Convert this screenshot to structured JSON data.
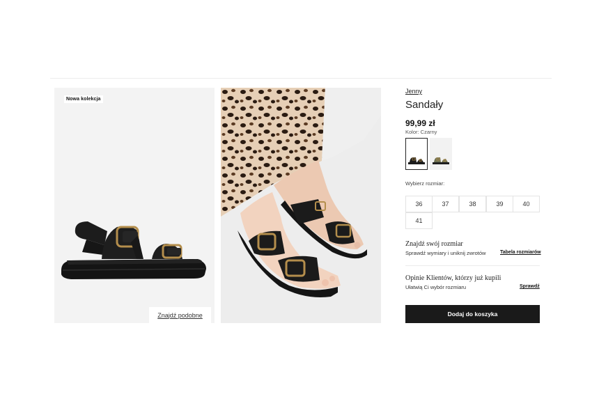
{
  "gallery": {
    "badge": "Nowa kolekcja",
    "find_similar": "Znajdź podobne"
  },
  "product": {
    "brand": "Jenny",
    "title": "Sandały",
    "price": "99,99 zł",
    "color_label": "Kolor: Czarny",
    "swatches": [
      {
        "name": "black",
        "color": "#1c1c1c",
        "selected": true
      },
      {
        "name": "olive",
        "color": "#6e7152",
        "selected": false
      }
    ],
    "size_label": "Wybierz rozmiar:",
    "sizes": [
      "36",
      "37",
      "38",
      "39",
      "40",
      "41"
    ]
  },
  "fit_finder": {
    "title": "Znajdź swój rozmiar",
    "subtitle": "Sprawdź wymiary i uniknij zwrotów",
    "link": "Tabela rozmiarów"
  },
  "reviews": {
    "title": "Opinie Klientów, którzy już kupili",
    "subtitle": "Ułatwią Ci wybór rozmiaru",
    "link": "Sprawdź"
  },
  "cart": {
    "add_label": "Dodaj do koszyka"
  },
  "colors": {
    "accent": "#1a1a1a",
    "gold": "#b48e4c",
    "leopard_base": "#e6cfb6",
    "leopard_spot": "#2a1b12"
  }
}
